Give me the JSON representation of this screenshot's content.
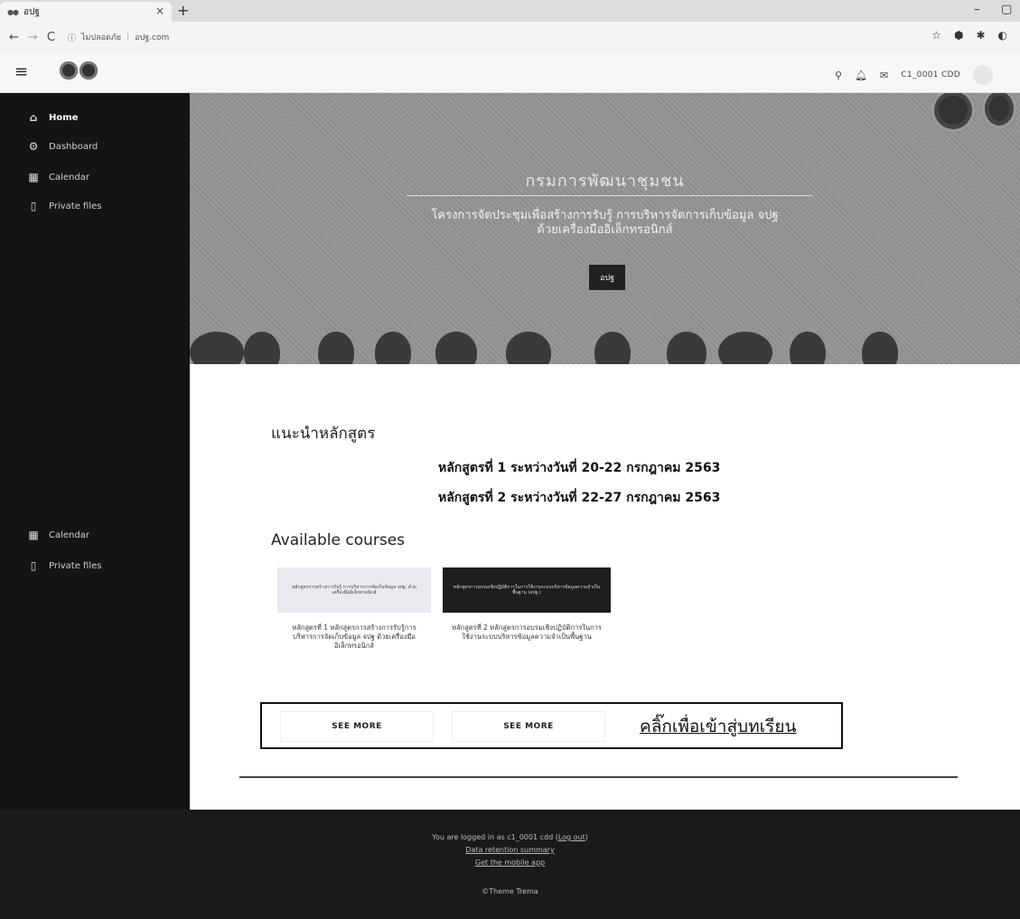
{
  "browser": {
    "tab_title": "อปฐ",
    "url_prefix": "ไม่ปลอดภัย",
    "url": "อปฐ.com",
    "minimize_glyph": "–",
    "restore_glyph": "▢"
  },
  "header": {
    "menu_glyph": "≡",
    "username": "C1_0001 CDD"
  },
  "sidebar": {
    "top_items": [
      {
        "label": "Home",
        "icon": "home-icon"
      },
      {
        "label": "Dashboard",
        "icon": "dashboard-icon"
      },
      {
        "label": "Calendar",
        "icon": "calendar-icon"
      },
      {
        "label": "Private files",
        "icon": "file-icon"
      }
    ],
    "bottom_items": [
      {
        "label": "Calendar",
        "icon": "calendar-icon"
      },
      {
        "label": "Private files",
        "icon": "file-icon"
      }
    ]
  },
  "hero": {
    "title": "กรมการพัฒนาชุมชน",
    "subtitle_line1": "โครงการจัดประชุมเพื่อสร้างการรับรู้ การบริหารจัดการเก็บข้อมูล จปฐ",
    "subtitle_line2": "ด้วยเครื่องมืออิเล็กทรอนิกส์",
    "button_label": "อปฐ"
  },
  "main": {
    "intro_heading": "แนะนำหลักสูตร",
    "course_lines": [
      "หลักสูตรที่ 1  ระหว่างวันที่ 20-22 กรกฎาคม 2563",
      "หลักสูตรที่ 2  ระหว่างวันที่ 22-27 กรกฎาคม 2563"
    ],
    "available_heading": "Available courses",
    "cards": [
      {
        "image_text": "หลักสูตรการสร้างการรับรู้ การบริหารการจัดเก็บข้อมูล จปฐ. ด้วยเครื่องมืออิเล็กทรอนิกส์",
        "description": "หลักสูตรที่ 1 หลักสูตรการสร้างการรับรู้การบริหารการจัดเก็บข้อมูล จปฐ ด้วยเครื่องมืออิเล็กทรอนิกส์",
        "button": "SEE MORE"
      },
      {
        "image_text": "หลักสูตรการอบรมเชิงปฏิบัติการในการใช้งานระบบบริหารข้อมูลความจำเป็นพื้นฐาน (จปฐ.)",
        "description": "หลักสูตรที่ 2 หลักสูตรการอบรมเชิงปฏิบัติการในการใช้งานระบบบริหารข้อมูลความจำเป็นพื้นฐาน",
        "button": "SEE MORE"
      }
    ],
    "callout": "คลิ๊กเพื่อเข้าสู่บทเรียน"
  },
  "footer": {
    "logged_in_prefix": "You are logged in as c1_0001 cdd (",
    "logout_label": "Log out",
    "logged_in_suffix": ")",
    "data_retention": "Data retention summary",
    "mobile_app": "Get the mobile app",
    "theme": "©Theme Trema"
  }
}
